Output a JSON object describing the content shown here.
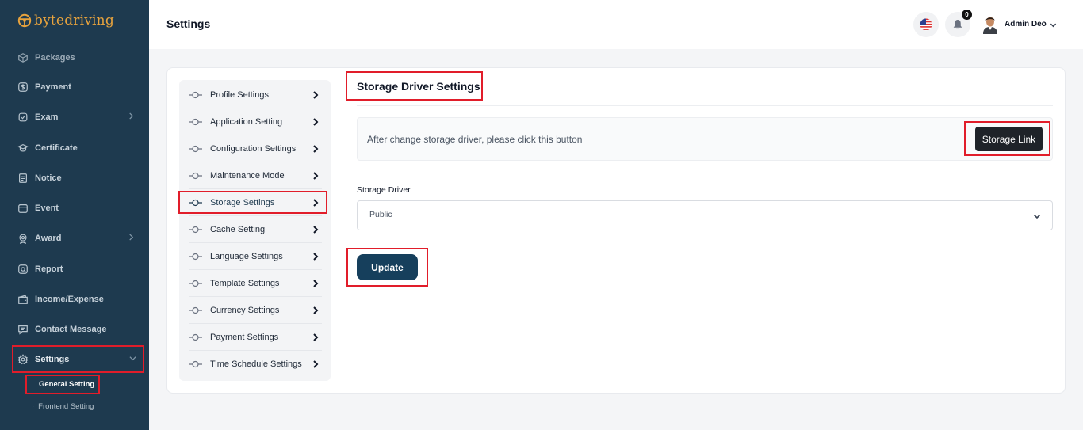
{
  "brand": {
    "name_part1": "byte",
    "name_part2": "driving"
  },
  "header": {
    "title": "Settings",
    "notifications_count": "0",
    "user_name": "Admin Deo"
  },
  "sidebar": {
    "items": [
      {
        "label": "Packages",
        "icon": "package-icon",
        "has_chevron": false
      },
      {
        "label": "Payment",
        "icon": "dollar-icon",
        "has_chevron": false
      },
      {
        "label": "Exam",
        "icon": "exam-icon",
        "has_chevron": true
      },
      {
        "label": "Certificate",
        "icon": "certificate-icon",
        "has_chevron": false
      },
      {
        "label": "Notice",
        "icon": "notice-icon",
        "has_chevron": false
      },
      {
        "label": "Event",
        "icon": "calendar-icon",
        "has_chevron": false
      },
      {
        "label": "Award",
        "icon": "award-icon",
        "has_chevron": true
      },
      {
        "label": "Report",
        "icon": "report-icon",
        "has_chevron": false
      },
      {
        "label": "Income/Expense",
        "icon": "wallet-icon",
        "has_chevron": false
      },
      {
        "label": "Contact Message",
        "icon": "message-icon",
        "has_chevron": false
      },
      {
        "label": "Settings",
        "icon": "gear-icon",
        "has_chevron": true,
        "expanded": true
      }
    ],
    "sub_items": [
      {
        "label": "General Setting",
        "active": true
      },
      {
        "label": "Frontend Setting",
        "active": false
      }
    ]
  },
  "settings_menu": {
    "items": [
      {
        "label": "Profile Settings"
      },
      {
        "label": "Application Setting"
      },
      {
        "label": "Configuration Settings"
      },
      {
        "label": "Maintenance Mode"
      },
      {
        "label": "Storage Settings",
        "active": true
      },
      {
        "label": "Cache Setting"
      },
      {
        "label": "Language Settings"
      },
      {
        "label": "Template Settings"
      },
      {
        "label": "Currency Settings"
      },
      {
        "label": "Payment Settings"
      },
      {
        "label": "Time Schedule Settings"
      }
    ]
  },
  "storage": {
    "title": "Storage Driver Settings",
    "notice_text": "After change storage driver, please click this button",
    "storage_link_label": "Storage Link",
    "driver_label": "Storage Driver",
    "driver_value": "Public",
    "update_label": "Update"
  },
  "colors": {
    "sidebar_bg": "#1e3a4f",
    "brand_accent": "#e8a33d",
    "primary_button": "#163f5c",
    "highlight": "#e11d2a"
  }
}
